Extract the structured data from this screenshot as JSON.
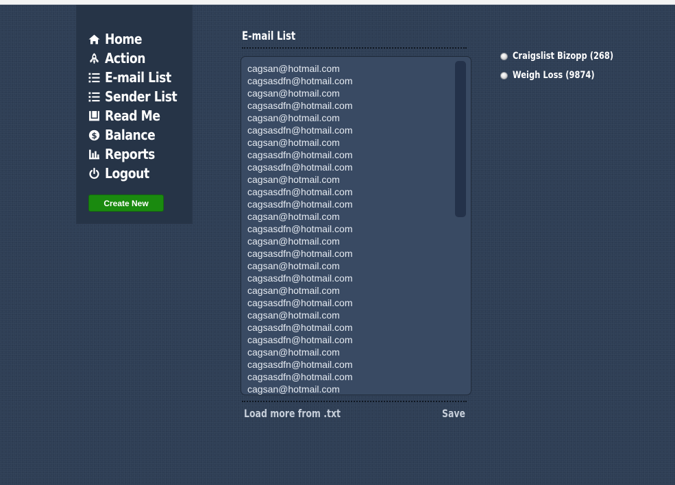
{
  "nav": {
    "items": [
      {
        "label": "Home",
        "icon": "home-icon"
      },
      {
        "label": "Action",
        "icon": "rocket-icon"
      },
      {
        "label": "E-mail List",
        "icon": "list-icon"
      },
      {
        "label": "Sender List",
        "icon": "list-icon"
      },
      {
        "label": "Read Me",
        "icon": "book-icon"
      },
      {
        "label": "Balance",
        "icon": "dollar-icon"
      },
      {
        "label": "Reports",
        "icon": "bar-chart-icon"
      },
      {
        "label": "Logout",
        "icon": "power-icon"
      }
    ],
    "create_label": "Create New"
  },
  "panel": {
    "title": "E-mail List",
    "emails": [
      "cagsan@hotmail.com",
      "cagsasdfn@hotmail.com",
      "cagsan@hotmail.com",
      "cagsasdfn@hotmail.com",
      "cagsan@hotmail.com",
      "cagsasdfn@hotmail.com",
      "cagsan@hotmail.com",
      "cagsasdfn@hotmail.com",
      "cagsasdfn@hotmail.com",
      "cagsan@hotmail.com",
      "cagsasdfn@hotmail.com",
      "cagsasdfn@hotmail.com",
      "cagsan@hotmail.com",
      "cagsasdfn@hotmail.com",
      "cagsan@hotmail.com",
      "cagsasdfn@hotmail.com",
      "cagsan@hotmail.com",
      "cagsasdfn@hotmail.com",
      "cagsan@hotmail.com",
      "cagsasdfn@hotmail.com",
      "cagsan@hotmail.com",
      "cagsasdfn@hotmail.com",
      "cagsasdfn@hotmail.com",
      "cagsan@hotmail.com",
      "cagsasdfn@hotmail.com",
      "cagsasdfn@hotmail.com",
      "cagsan@hotmail.com"
    ],
    "load_more_label": "Load more from .txt",
    "save_label": "Save"
  },
  "lists": [
    {
      "label": "Craigslist Bizopp (268)"
    },
    {
      "label": "Weigh Loss (9874)"
    }
  ],
  "colors": {
    "background": "#2e3e55",
    "sidebar": "#263447",
    "textarea": "#394a63",
    "create_button": "#1a8a0f"
  }
}
